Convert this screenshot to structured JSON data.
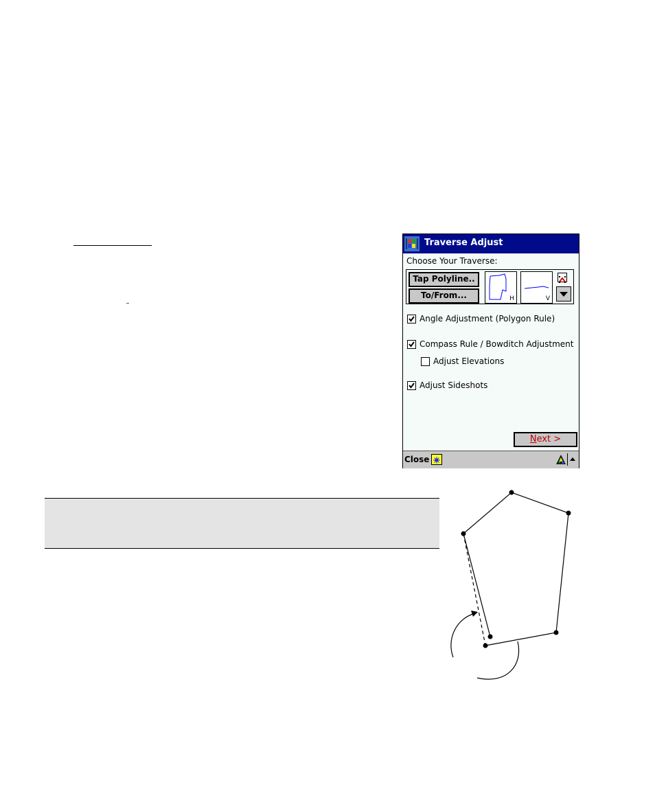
{
  "window": {
    "title": "Traverse Adjust",
    "choose_label": "Choose Your Traverse:",
    "buttons": {
      "tap_polyline": "Tap Polyline..",
      "to_from": "To/From...",
      "next": "Next >",
      "next_mnemonic": "N",
      "next_rest": "ext >"
    },
    "previews": {
      "horizontal_label": "H",
      "vertical_label": "V"
    },
    "options": [
      {
        "label": "Angle Adjustment (Polygon Rule)",
        "checked": true
      },
      {
        "label": "Compass Rule / Bowditch Adjustment",
        "checked": true
      },
      {
        "label": "Adjust Elevations",
        "checked": false
      },
      {
        "label": "Adjust Sideshots",
        "checked": true
      }
    ]
  },
  "taskbar": {
    "close_label": "Close",
    "icons": [
      "input-panel-icon",
      "triangle-logo-icon",
      "up-arrow-icon"
    ]
  },
  "colors": {
    "titlebar": "#000b8c",
    "next_text": "#c00000",
    "preview_line": "#0000ff",
    "note_box": "#e4e4e4"
  }
}
